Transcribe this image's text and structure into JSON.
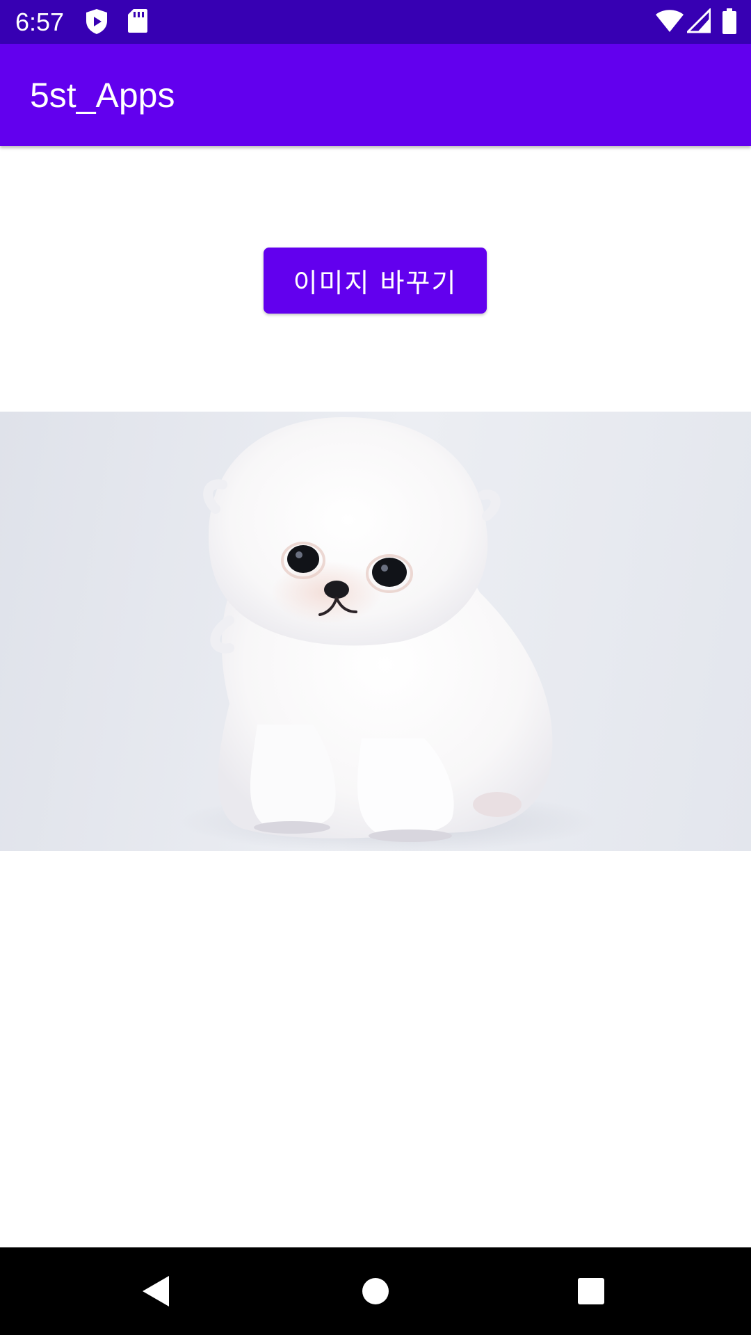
{
  "status_bar": {
    "time": "6:57",
    "icons": [
      "shield-play-icon",
      "sd-card-icon",
      "wifi-icon",
      "signal-icon",
      "battery-icon"
    ]
  },
  "app_bar": {
    "title": "5st_Apps"
  },
  "main": {
    "change_image_button_label": "이미지 바꾸기",
    "image": "white-pomeranian-puppy-photo"
  },
  "nav_bar": {
    "icons": [
      "back-icon",
      "home-icon",
      "recents-icon"
    ]
  },
  "colors": {
    "status_bar": "#3700B3",
    "primary": "#6200EE",
    "background": "#FFFFFF",
    "nav_bar": "#000000"
  }
}
